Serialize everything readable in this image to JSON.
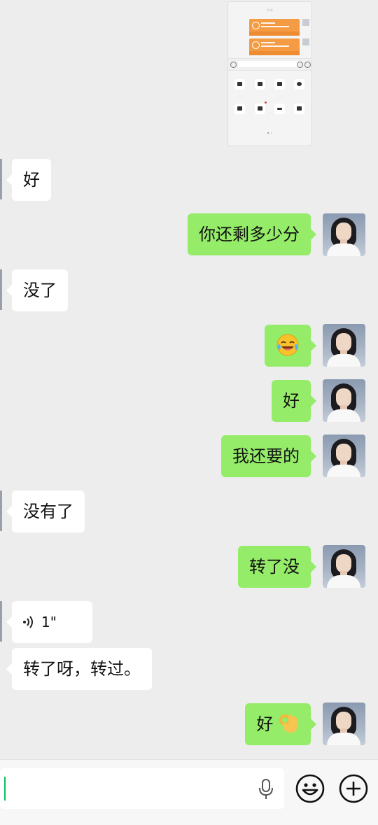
{
  "forwarded_screenshot": {
    "time_label": "下午",
    "cards": [
      "",
      ""
    ],
    "tools": [
      "",
      "",
      "",
      "",
      "",
      "",
      "",
      ""
    ]
  },
  "messages": [
    {
      "side": "left",
      "text": "好"
    },
    {
      "side": "right",
      "text": "你还剩多少分"
    },
    {
      "side": "left",
      "text": "没了"
    },
    {
      "side": "right",
      "text": ""
    },
    {
      "side": "right",
      "text": "好"
    },
    {
      "side": "right",
      "text": "我还要的"
    },
    {
      "side": "left",
      "text": "没有了"
    },
    {
      "side": "right",
      "text": "转了没"
    },
    {
      "side": "left",
      "type": "voice",
      "duration": "1\""
    },
    {
      "side": "left",
      "text": "转了呀，转过。"
    },
    {
      "side": "right",
      "text": "好",
      "emoji": "ok-hand"
    }
  ],
  "input": {
    "value": ""
  },
  "colors": {
    "background": "#ededed",
    "bubble_right": "#95ec69",
    "bubble_left": "#ffffff",
    "caret": "#07c160"
  }
}
